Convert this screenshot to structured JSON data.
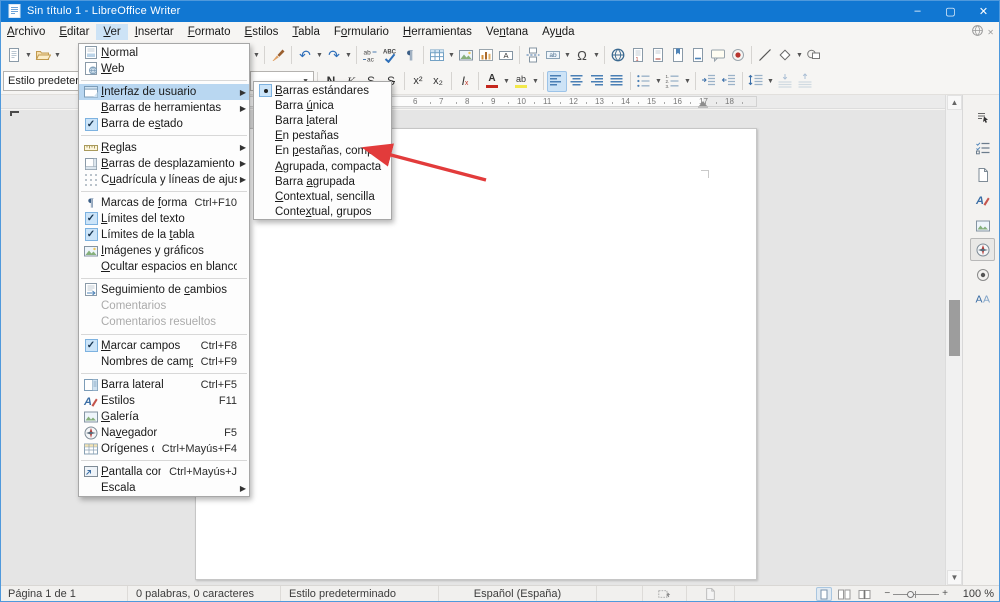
{
  "window": {
    "title": "Sin título 1 - LibreOffice Writer",
    "controls": {
      "minimize": "–",
      "maximize": "▢",
      "close": "✕"
    }
  },
  "menubar": {
    "items": [
      {
        "label": "Archivo",
        "u": 0
      },
      {
        "label": "Editar",
        "u": 0
      },
      {
        "label": "Ver",
        "u": 0,
        "active": true
      },
      {
        "label": "Insertar",
        "u": 0
      },
      {
        "label": "Formato",
        "u": 0
      },
      {
        "label": "Estilos",
        "u": 0
      },
      {
        "label": "Tabla",
        "u": 0
      },
      {
        "label": "Formulario",
        "u": 1
      },
      {
        "label": "Herramientas",
        "u": 0
      },
      {
        "label": "Ventana",
        "u": 2
      },
      {
        "label": "Ayuda",
        "u": 2
      }
    ]
  },
  "standard_toolbar": {
    "left": [
      "new-document",
      "dd",
      "open-folder",
      "dd"
    ],
    "right": [
      "dd",
      "|",
      "clone-formatting",
      "|",
      "undo",
      "dd",
      "redo",
      "dd",
      "|",
      "find-replace",
      "spelling",
      "formatting-marks",
      "|",
      "insert-table",
      "dd",
      "insert-image",
      "insert-chart",
      "insert-textbox",
      "|",
      "page-break",
      "insert-field",
      "dd",
      "special-character",
      "dd",
      "|",
      "insert-hyperlink",
      "insert-footnote",
      "insert-endnote",
      "insert-bookmark",
      "insert-cross-reference",
      "insert-comment",
      "record-changes",
      "|",
      "insert-line",
      "basic-shapes",
      "dd",
      "draw-functions"
    ]
  },
  "formatting_toolbar": {
    "style_combo": "Estilo predetermi",
    "tokens": [
      {
        "combo": true
      },
      {
        "sep": true
      },
      {
        "icon": "bold"
      },
      {
        "icon": "italic"
      },
      {
        "icon": "underline"
      },
      {
        "icon": "strikethrough"
      },
      {
        "sep": true
      },
      {
        "icon": "superscript"
      },
      {
        "icon": "subscript"
      },
      {
        "sep": true
      },
      {
        "icon": "clear-formatting"
      },
      {
        "sep": true
      },
      {
        "icon": "font-color"
      },
      {
        "dd": true
      },
      {
        "icon": "highlight-color"
      },
      {
        "dd": true
      },
      {
        "sep": true
      },
      {
        "icon": "align-left",
        "active": true
      },
      {
        "icon": "align-center"
      },
      {
        "icon": "align-right"
      },
      {
        "icon": "align-justify"
      },
      {
        "sep": true
      },
      {
        "icon": "bullet-list"
      },
      {
        "dd": true
      },
      {
        "icon": "numbered-list"
      },
      {
        "dd": true
      },
      {
        "sep": true
      },
      {
        "icon": "indent-increase"
      },
      {
        "icon": "indent-decrease"
      },
      {
        "sep": true
      },
      {
        "icon": "line-spacing"
      },
      {
        "dd": true
      },
      {
        "icon": "para-space-increase",
        "disabled": true
      },
      {
        "icon": "para-space-decrease",
        "disabled": true
      }
    ]
  },
  "view_menu": {
    "items": [
      {
        "icon": "doc-normal",
        "label": "Normal",
        "u": 0
      },
      {
        "icon": "doc-web",
        "label": "Web",
        "u": 0
      },
      {
        "type": "sep"
      },
      {
        "icon": "ui-layout",
        "label": "Interfaz de usuario",
        "u": 0,
        "submenu": true,
        "highlighted": true
      },
      {
        "label": "Barras de herramientas",
        "u": 0,
        "submenu": true
      },
      {
        "check": true,
        "label": "Barra de estado",
        "u": 10
      },
      {
        "type": "sep"
      },
      {
        "icon": "ruler",
        "label": "Reglas",
        "u": 0,
        "submenu": true
      },
      {
        "icon": "scrollbars",
        "label": "Barras de desplazamiento",
        "u": 0,
        "submenu": true
      },
      {
        "icon": "grid",
        "label": "Cuadrícula y líneas de ajuste",
        "u": 1,
        "submenu": true
      },
      {
        "type": "sep"
      },
      {
        "icon": "pilcrow",
        "label": "Marcas de formato",
        "u": 10,
        "shortcut": "Ctrl+F10"
      },
      {
        "check": true,
        "label": "Límites del texto",
        "u": 0
      },
      {
        "check": true,
        "label": "Límites de la tabla",
        "u": 14
      },
      {
        "icon": "image",
        "label": "Imágenes y gráficos",
        "u": 0
      },
      {
        "label": "Ocultar espacios en blanco",
        "u": 0
      },
      {
        "type": "sep"
      },
      {
        "icon": "track-changes",
        "label": "Seguimiento de cambios",
        "u": 15
      },
      {
        "label": "Comentarios",
        "disabled": true
      },
      {
        "label": "Comentarios resueltos",
        "disabled": true
      },
      {
        "type": "sep"
      },
      {
        "check": true,
        "label": "Marcar campos",
        "u": 0,
        "shortcut": "Ctrl+F8"
      },
      {
        "label": "Nombres de campo",
        "u": 14,
        "shortcut": "Ctrl+F9"
      },
      {
        "type": "sep"
      },
      {
        "icon": "sidebar",
        "label": "Barra lateral",
        "shortcut": "Ctrl+F5"
      },
      {
        "icon": "styles",
        "label": "Estilos",
        "shortcut": "F11"
      },
      {
        "icon": "gallery",
        "label": "Galería",
        "u": 0
      },
      {
        "icon": "navigator",
        "label": "Navegador",
        "u": 2,
        "shortcut": "F5"
      },
      {
        "icon": "datasources",
        "label": "Orígenes de datos",
        "u": 12,
        "shortcut": "Ctrl+Mayús+F4"
      },
      {
        "type": "sep"
      },
      {
        "icon": "fullscreen",
        "label": "Pantalla completa",
        "u": 0,
        "shortcut": "Ctrl+Mayús+J"
      },
      {
        "label": "Escala",
        "submenu": true
      }
    ]
  },
  "ui_submenu": {
    "items": [
      {
        "label": "Barras estándares",
        "u": 0,
        "selected": true
      },
      {
        "label": "Barra única",
        "u": 6
      },
      {
        "label": "Barra lateral",
        "u": 6
      },
      {
        "label": "En pestañas",
        "u": 0
      },
      {
        "label": "En pestañas, compacta",
        "u": 3
      },
      {
        "label": "Agrupada, compacta",
        "u": 0
      },
      {
        "label": "Barra agrupada",
        "u": 6
      },
      {
        "label": "Contextual, sencilla",
        "u": 0
      },
      {
        "label": "Contextual, grupos",
        "u": 5
      }
    ]
  },
  "ruler": {
    "numbers": [
      6,
      7,
      8,
      9,
      10,
      11,
      12,
      13,
      14,
      15,
      16,
      17,
      18
    ]
  },
  "sidebar": {
    "tabs": [
      "sidebar-settings",
      "properties",
      "page",
      "styles",
      "gallery",
      "navigator",
      "manage-changes",
      "style-inspector"
    ],
    "active": "navigator"
  },
  "status_bar": {
    "page_count": "Página 1 de 1",
    "word_count": "0 palabras, 0 caracteres",
    "page_style": "Estilo predeterminado",
    "language": "Español (España)",
    "zoom_level": "100 %"
  },
  "colors": {
    "titlebar": "#1177d2",
    "menu_highlight": "#b9d7f1",
    "check_bg": "#cbe4f9",
    "annotation_arrow": "#e23b3b"
  }
}
